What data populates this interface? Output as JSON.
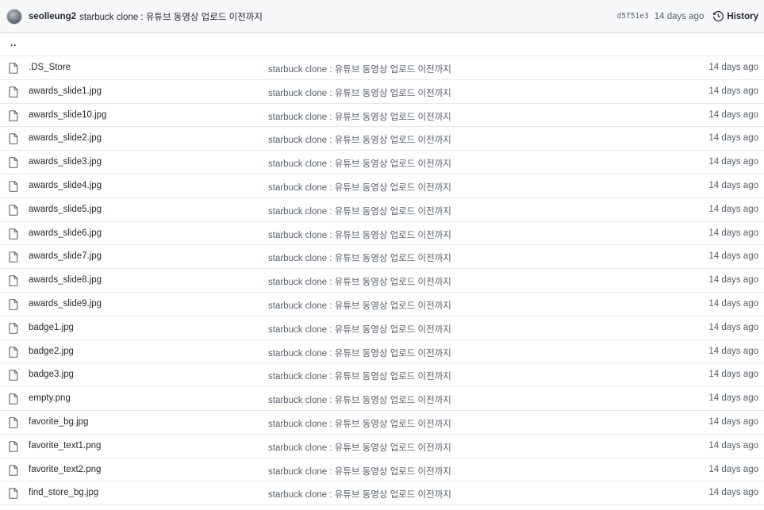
{
  "commit": {
    "author": "seolleung2",
    "message": "starbuck clone : 유튜브 동영상 업로드 이전까지",
    "sha": "d5f51e3",
    "age": "14 days ago",
    "history_label": "History"
  },
  "parent_link": "..",
  "files": [
    {
      "name": ".DS_Store",
      "message": "starbuck clone : 유튜브 동영상 업로드 이전까지",
      "age": "14 days ago"
    },
    {
      "name": "awards_slide1.jpg",
      "message": "starbuck clone : 유튜브 동영상 업로드 이전까지",
      "age": "14 days ago"
    },
    {
      "name": "awards_slide10.jpg",
      "message": "starbuck clone : 유튜브 동영상 업로드 이전까지",
      "age": "14 days ago"
    },
    {
      "name": "awards_slide2.jpg",
      "message": "starbuck clone : 유튜브 동영상 업로드 이전까지",
      "age": "14 days ago"
    },
    {
      "name": "awards_slide3.jpg",
      "message": "starbuck clone : 유튜브 동영상 업로드 이전까지",
      "age": "14 days ago"
    },
    {
      "name": "awards_slide4.jpg",
      "message": "starbuck clone : 유튜브 동영상 업로드 이전까지",
      "age": "14 days ago"
    },
    {
      "name": "awards_slide5.jpg",
      "message": "starbuck clone : 유튜브 동영상 업로드 이전까지",
      "age": "14 days ago"
    },
    {
      "name": "awards_slide6.jpg",
      "message": "starbuck clone : 유튜브 동영상 업로드 이전까지",
      "age": "14 days ago"
    },
    {
      "name": "awards_slide7.jpg",
      "message": "starbuck clone : 유튜브 동영상 업로드 이전까지",
      "age": "14 days ago"
    },
    {
      "name": "awards_slide8.jpg",
      "message": "starbuck clone : 유튜브 동영상 업로드 이전까지",
      "age": "14 days ago"
    },
    {
      "name": "awards_slide9.jpg",
      "message": "starbuck clone : 유튜브 동영상 업로드 이전까지",
      "age": "14 days ago"
    },
    {
      "name": "badge1.jpg",
      "message": "starbuck clone : 유튜브 동영상 업로드 이전까지",
      "age": "14 days ago"
    },
    {
      "name": "badge2.jpg",
      "message": "starbuck clone : 유튜브 동영상 업로드 이전까지",
      "age": "14 days ago"
    },
    {
      "name": "badge3.jpg",
      "message": "starbuck clone : 유튜브 동영상 업로드 이전까지",
      "age": "14 days ago"
    },
    {
      "name": "empty.png",
      "message": "starbuck clone : 유튜브 동영상 업로드 이전까지",
      "age": "14 days ago"
    },
    {
      "name": "favorite_bg.jpg",
      "message": "starbuck clone : 유튜브 동영상 업로드 이전까지",
      "age": "14 days ago"
    },
    {
      "name": "favorite_text1.png",
      "message": "starbuck clone : 유튜브 동영상 업로드 이전까지",
      "age": "14 days ago"
    },
    {
      "name": "favorite_text2.png",
      "message": "starbuck clone : 유튜브 동영상 업로드 이전까지",
      "age": "14 days ago"
    },
    {
      "name": "find_store_bg.jpg",
      "message": "starbuck clone : 유튜브 동영상 업로드 이전까지",
      "age": "14 days ago"
    }
  ]
}
